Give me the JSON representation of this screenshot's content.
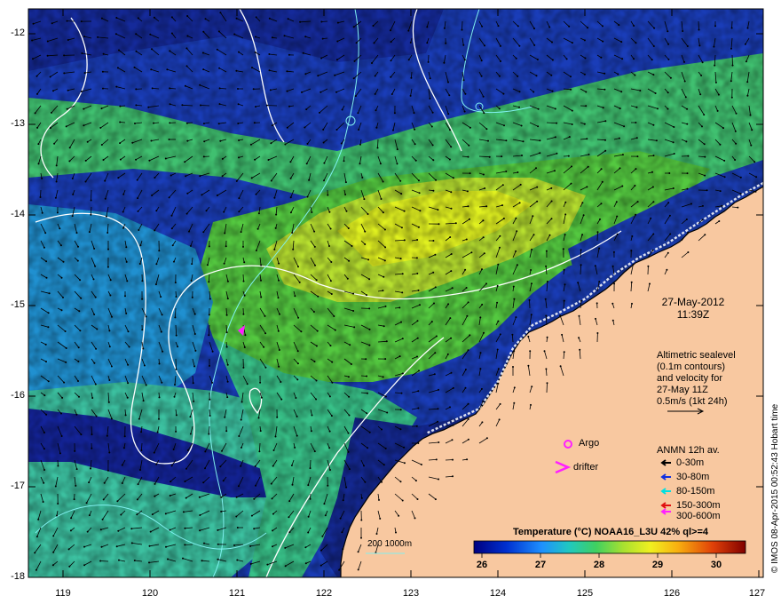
{
  "map": {
    "date": "27-May-2012",
    "time": "11:39Z",
    "altimetry_lines": [
      "Altimetric sealevel",
      "(0.1m contours)",
      "and velocity for",
      "27-May 11Z",
      "0.5m/s (1kt 24h)"
    ],
    "argo_label": "Argo",
    "drifter_label": "drifter",
    "anmn_title": "ANMN 12h av.",
    "anmn_legend": [
      {
        "label": "0-30m",
        "color": "#000000"
      },
      {
        "label": "30-80m",
        "color": "#1030e0"
      },
      {
        "label": "80-150m",
        "color": "#00e0e0"
      },
      {
        "label": "150-300m",
        "color": "#e01010"
      },
      {
        "label": "300-600m",
        "color": "#ff20ff"
      }
    ],
    "depth_contour_label": "200  1000m",
    "colorbar_title": "Temperature (°C) NOAA16_L3U 42% ql>=4",
    "colorbar_ticks": [
      "26",
      "27",
      "28",
      "29",
      "30"
    ],
    "lat_ticks": [
      "-12",
      "-13",
      "-14",
      "-15",
      "-16",
      "-17",
      "-18"
    ],
    "lon_ticks": [
      "119",
      "120",
      "121",
      "122",
      "123",
      "124",
      "125",
      "126",
      "127"
    ],
    "credit": "© IMOS 08-Apr-2015 00:52:43 Hobart time",
    "colors": {
      "land": "#f8c8a0",
      "deep_blue": "#1a2aa0",
      "mid_blue": "#1f6fd8",
      "cyan": "#2ab8c8",
      "teal_green": "#3cc890",
      "green": "#58d048",
      "yellow_green": "#b8e830",
      "yellow": "#e8f020",
      "contour_white": "#ffffff",
      "contour_cyan": "#80f0f0",
      "magenta": "#ff20ff"
    }
  }
}
